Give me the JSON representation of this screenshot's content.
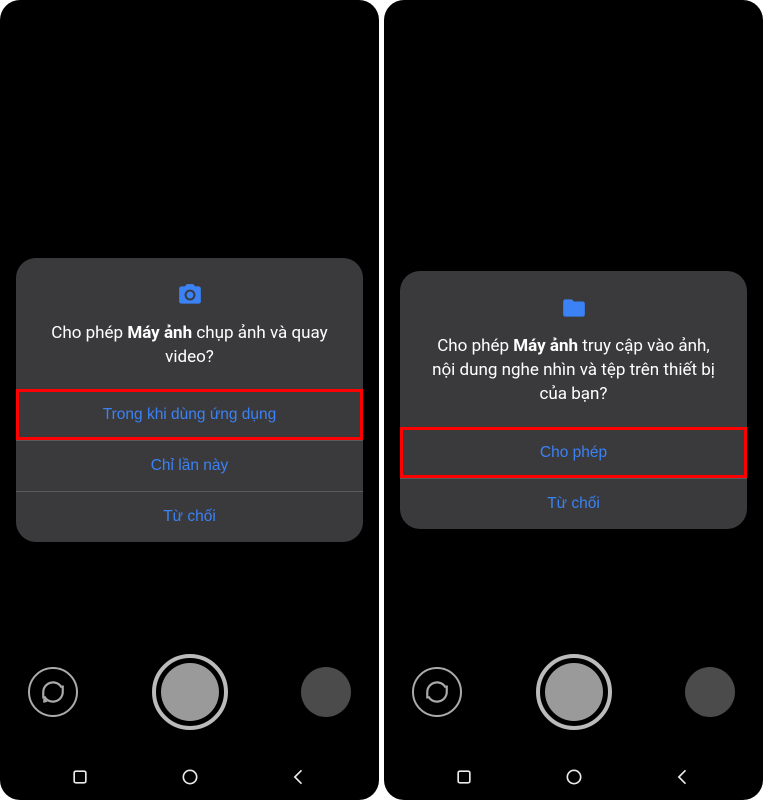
{
  "left": {
    "dialog": {
      "icon": "camera-icon",
      "prefix": "Cho phép ",
      "bold": "Máy ảnh",
      "suffix": " chụp ảnh và quay video?",
      "buttons": [
        {
          "label": "Trong khi dùng ứng dụng",
          "highlighted": true
        },
        {
          "label": "Chỉ lần này",
          "highlighted": false
        },
        {
          "label": "Từ chối",
          "highlighted": false
        }
      ]
    }
  },
  "right": {
    "dialog": {
      "icon": "folder-icon",
      "prefix": "Cho phép ",
      "bold": "Máy ảnh",
      "suffix": " truy cập vào ảnh, nội dung nghe nhìn và tệp trên thiết bị của bạn?",
      "buttons": [
        {
          "label": "Cho phép",
          "highlighted": true
        },
        {
          "label": "Từ chối",
          "highlighted": false
        }
      ]
    }
  }
}
